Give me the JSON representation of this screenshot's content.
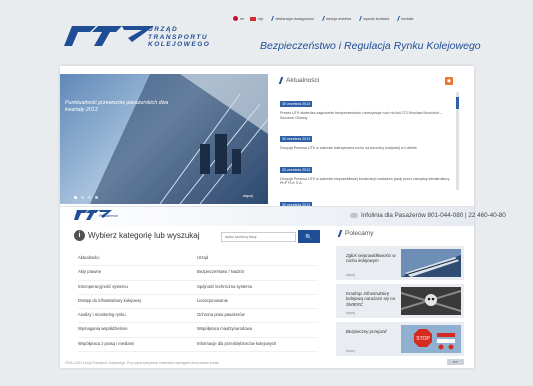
{
  "header": {
    "logo_lines": [
      "URZĄD",
      "TRANSPORTU",
      "KOLEJOWEGO"
    ],
    "site_title": "Bezpieczeństwo i Regulacja Rynku Kolejowego",
    "topnav": [
      {
        "label": "en",
        "icon": "uk-flag-icon"
      },
      {
        "label": "bip",
        "icon": "bip-icon"
      },
      {
        "label": "deklaracja dostępności",
        "icon": "slash-icon"
      },
      {
        "label": "wersja mobilna",
        "icon": "slash-icon"
      },
      {
        "label": "wysoki kontrast",
        "icon": "slash-icon"
      },
      {
        "label": "kontakt",
        "icon": "slash-icon"
      }
    ]
  },
  "banner": {
    "caption": "Punktualność przewozów pasażerskich dwa kwartały 2013",
    "more_label": "więcej",
    "slide_count": 4
  },
  "news": {
    "heading": "Aktualności",
    "items": [
      {
        "date": "30 września 2013",
        "text": "Prezes UTK stwierdza zagrożenie bezpieczeństwa i wstrzymuje ruch na linii 273 Wrocław Muchobór – Szczecin Główny"
      },
      {
        "date": "30 września 2013",
        "text": "Decyzja Prezesa UTK w zakresie wstrzymania ruchu na bocznicy kolejowej w Lublinie"
      },
      {
        "date": "30 września 2013",
        "text": "Decyzja Prezesa UTK w zakresie nieprawidłowej konstrukcji rozkładów jazdy przez zarządcę infrastruktury PKP PLK S.A."
      },
      {
        "date": "30 września 2013",
        "text": "Punktualność kolejowych przewozów towarowych za dwa kwartały 2013"
      }
    ]
  },
  "strip": {
    "small_logo_caption": "Pasażerów",
    "infoline": "Infolinia dla Pasażerów  801-044-080 | 22 460-40-80"
  },
  "categories": {
    "heading": "Wybierz kategorię lub wyszukaj",
    "search_placeholder": "wpisz szukaną frazę",
    "search_button": "🔍",
    "items": [
      "Aktualności",
      "Urząd",
      "Akty prawne",
      "Bezpieczeństwo / Nadzór",
      "Interoperacyjność systemu",
      "Spójność techniczna systemu",
      "Dostęp do infrastruktury kolejowej",
      "Licencjonowanie",
      "Analizy i monitoring rynku",
      "Ochrona praw pasażerów",
      "Wymagania współdzielone",
      "Współpraca międzynarodowa",
      "Współpraca z prasą i mediami",
      "Informacje dla przedsiębiorców kolejowych"
    ]
  },
  "recommended": {
    "heading": "Polecamy",
    "promos": [
      {
        "text": "Zgłoś nieprawidłowości w ruchu kolejowym",
        "more": "więcej"
      },
      {
        "text": "Kradnąc infrastrukturę kolejową narażasz się na ŚMIERĆ",
        "more": "więcej"
      },
      {
        "text": "Bezpieczny przejazd",
        "more": "więcej"
      }
    ]
  },
  "footer": {
    "text": "©2011-2013 Urząd Transportu Kolejowego. Przy wykorzystywaniu materiałów wymagane jest podanie źródła.",
    "badge": "BIP"
  },
  "colors": {
    "brand": "#1f4e96",
    "rss": "#e8762b",
    "background": "#e9ecef"
  }
}
